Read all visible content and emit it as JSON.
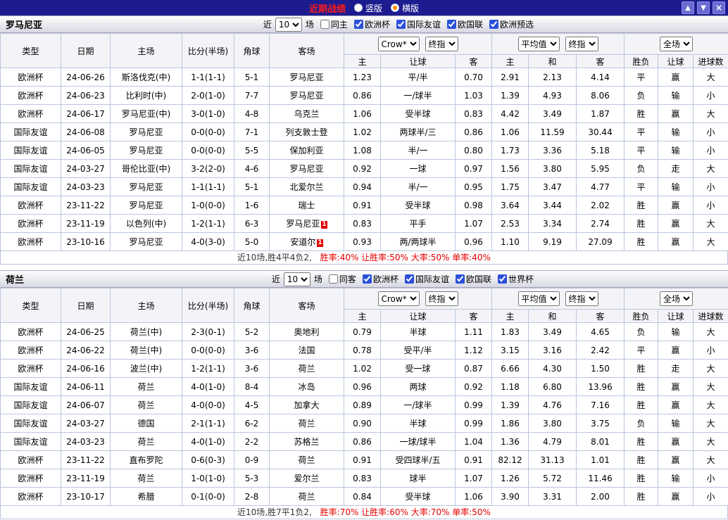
{
  "titlebar": {
    "title": "近期战绩",
    "vertical_label": "竖版",
    "horizontal_label": "横版",
    "up_button": "▲",
    "down_button": "▼",
    "close_button": "×"
  },
  "filter_labels": {
    "near": "近",
    "unit": "场"
  },
  "table_header": {
    "type": "类型",
    "date": "日期",
    "home": "主场",
    "score": "比分(半场)",
    "corners": "角球",
    "away": "客场",
    "crow": "Crow*",
    "final": "终指",
    "average": "平均值",
    "fulltime": "全场",
    "sub_home": "主",
    "sub_handicap": "让球",
    "sub_away": "客",
    "sub_draw": "和",
    "sub_outcome": "胜负",
    "sub_goals": "进球数"
  },
  "colors": {
    "titlebar_bg": "#1c1c90",
    "title_text": "#ff1a1a",
    "euro_type_bg": "#8d1010",
    "friendly_type_bg": "#2a2ac0",
    "focus_team": "#009900",
    "score_text": "#e60000",
    "win_big": "#e60000",
    "draw_lose": "#009900",
    "small": "#2727cc"
  },
  "sections": [
    {
      "team": "罗马尼亚",
      "filter": {
        "count": "10",
        "same_label": "同主",
        "same_checked": false,
        "leagues": [
          "欧洲杯",
          "国际友谊",
          "欧国联",
          "欧洲预选"
        ]
      },
      "rows": [
        {
          "type": "欧洲杯",
          "date": "24-06-26",
          "home": "斯洛伐克(中)",
          "home_focus": false,
          "score": "1-1(1-1)",
          "corners": "5-1",
          "away": "罗马尼亚",
          "away_focus": true,
          "away_red_card": "",
          "crow_home": "1.23",
          "handicap": "平/半",
          "crow_away": "0.70",
          "avg_home": "2.91",
          "avg_draw": "2.13",
          "avg_away": "4.14",
          "outcome": "平",
          "handicap_result": "赢",
          "goals_result": "大"
        },
        {
          "type": "欧洲杯",
          "date": "24-06-23",
          "home": "比利时(中)",
          "home_focus": false,
          "score": "2-0(1-0)",
          "corners": "7-7",
          "away": "罗马尼亚",
          "away_focus": true,
          "away_red_card": "",
          "crow_home": "0.86",
          "handicap": "一/球半",
          "crow_away": "1.03",
          "avg_home": "1.39",
          "avg_draw": "4.93",
          "avg_away": "8.06",
          "outcome": "负",
          "handicap_result": "输",
          "goals_result": "小"
        },
        {
          "type": "欧洲杯",
          "date": "24-06-17",
          "home": "罗马尼亚(中)",
          "home_focus": true,
          "score": "3-0(1-0)",
          "corners": "4-8",
          "away": "乌克兰",
          "away_focus": false,
          "away_red_card": "",
          "crow_home": "1.06",
          "handicap": "受半球",
          "crow_away": "0.83",
          "avg_home": "4.42",
          "avg_draw": "3.49",
          "avg_away": "1.87",
          "outcome": "胜",
          "handicap_result": "赢",
          "goals_result": "大"
        },
        {
          "type": "国际友谊",
          "date": "24-06-08",
          "home": "罗马尼亚",
          "home_focus": true,
          "score": "0-0(0-0)",
          "corners": "7-1",
          "away": "列支敦士登",
          "away_focus": false,
          "away_red_card": "",
          "crow_home": "1.02",
          "handicap": "两球半/三",
          "crow_away": "0.86",
          "avg_home": "1.06",
          "avg_draw": "11.59",
          "avg_away": "30.44",
          "outcome": "平",
          "handicap_result": "输",
          "goals_result": "小"
        },
        {
          "type": "国际友谊",
          "date": "24-06-05",
          "home": "罗马尼亚",
          "home_focus": true,
          "score": "0-0(0-0)",
          "corners": "5-5",
          "away": "保加利亚",
          "away_focus": false,
          "away_red_card": "",
          "crow_home": "1.08",
          "handicap": "半/一",
          "crow_away": "0.80",
          "avg_home": "1.73",
          "avg_draw": "3.36",
          "avg_away": "5.18",
          "outcome": "平",
          "handicap_result": "输",
          "goals_result": "小"
        },
        {
          "type": "国际友谊",
          "date": "24-03-27",
          "home": "哥伦比亚(中)",
          "home_focus": false,
          "score": "3-2(2-0)",
          "corners": "4-6",
          "away": "罗马尼亚",
          "away_focus": true,
          "away_red_card": "",
          "crow_home": "0.92",
          "handicap": "一球",
          "crow_away": "0.97",
          "avg_home": "1.56",
          "avg_draw": "3.80",
          "avg_away": "5.95",
          "outcome": "负",
          "handicap_result": "走",
          "goals_result": "大"
        },
        {
          "type": "国际友谊",
          "date": "24-03-23",
          "home": "罗马尼亚",
          "home_focus": true,
          "score": "1-1(1-1)",
          "corners": "5-1",
          "away": "北爱尔兰",
          "away_focus": false,
          "away_red_card": "",
          "crow_home": "0.94",
          "handicap": "半/一",
          "crow_away": "0.95",
          "avg_home": "1.75",
          "avg_draw": "3.47",
          "avg_away": "4.77",
          "outcome": "平",
          "handicap_result": "输",
          "goals_result": "小"
        },
        {
          "type": "欧洲杯",
          "date": "23-11-22",
          "home": "罗马尼亚",
          "home_focus": true,
          "score": "1-0(0-0)",
          "corners": "1-6",
          "away": "瑞士",
          "away_focus": false,
          "away_red_card": "",
          "crow_home": "0.91",
          "handicap": "受半球",
          "crow_away": "0.98",
          "avg_home": "3.64",
          "avg_draw": "3.44",
          "avg_away": "2.02",
          "outcome": "胜",
          "handicap_result": "赢",
          "goals_result": "小"
        },
        {
          "type": "欧洲杯",
          "date": "23-11-19",
          "home": "以色列(中)",
          "home_focus": false,
          "score": "1-2(1-1)",
          "corners": "6-3",
          "away": "罗马尼亚",
          "away_focus": true,
          "away_red_card": "1",
          "crow_home": "0.83",
          "handicap": "平手",
          "crow_away": "1.07",
          "avg_home": "2.53",
          "avg_draw": "3.34",
          "avg_away": "2.74",
          "outcome": "胜",
          "handicap_result": "赢",
          "goals_result": "大"
        },
        {
          "type": "欧洲杯",
          "date": "23-10-16",
          "home": "罗马尼亚",
          "home_focus": true,
          "score": "4-0(3-0)",
          "corners": "5-0",
          "away": "安道尔",
          "away_focus": false,
          "away_red_card": "1",
          "crow_home": "0.93",
          "handicap": "两/两球半",
          "crow_away": "0.96",
          "avg_home": "1.10",
          "avg_draw": "9.19",
          "avg_away": "27.09",
          "outcome": "胜",
          "handicap_result": "赢",
          "goals_result": "大"
        }
      ],
      "summary": {
        "prefix": "近10场,胜4平4负2,",
        "stats": "胜率:40%  让胜率:50%  大率:50%  单率:40%"
      }
    },
    {
      "team": "荷兰",
      "filter": {
        "count": "10",
        "same_label": "同客",
        "same_checked": false,
        "leagues": [
          "欧洲杯",
          "国际友谊",
          "欧国联",
          "世界杯"
        ]
      },
      "rows": [
        {
          "type": "欧洲杯",
          "date": "24-06-25",
          "home": "荷兰(中)",
          "home_focus": true,
          "score": "2-3(0-1)",
          "corners": "5-2",
          "away": "奥地利",
          "away_focus": false,
          "away_red_card": "",
          "crow_home": "0.79",
          "handicap": "半球",
          "crow_away": "1.11",
          "avg_home": "1.83",
          "avg_draw": "3.49",
          "avg_away": "4.65",
          "outcome": "负",
          "handicap_result": "输",
          "goals_result": "大"
        },
        {
          "type": "欧洲杯",
          "date": "24-06-22",
          "home": "荷兰(中)",
          "home_focus": true,
          "score": "0-0(0-0)",
          "corners": "3-6",
          "away": "法国",
          "away_focus": false,
          "away_red_card": "",
          "crow_home": "0.78",
          "handicap": "受平/半",
          "crow_away": "1.12",
          "avg_home": "3.15",
          "avg_draw": "3.16",
          "avg_away": "2.42",
          "outcome": "平",
          "handicap_result": "赢",
          "goals_result": "小"
        },
        {
          "type": "欧洲杯",
          "date": "24-06-16",
          "home": "波兰(中)",
          "home_focus": false,
          "score": "1-2(1-1)",
          "corners": "3-6",
          "away": "荷兰",
          "away_focus": true,
          "away_red_card": "",
          "crow_home": "1.02",
          "handicap": "受一球",
          "crow_away": "0.87",
          "avg_home": "6.66",
          "avg_draw": "4.30",
          "avg_away": "1.50",
          "outcome": "胜",
          "handicap_result": "走",
          "goals_result": "大"
        },
        {
          "type": "国际友谊",
          "date": "24-06-11",
          "home": "荷兰",
          "home_focus": true,
          "score": "4-0(1-0)",
          "corners": "8-4",
          "away": "冰岛",
          "away_focus": false,
          "away_red_card": "",
          "crow_home": "0.96",
          "handicap": "两球",
          "crow_away": "0.92",
          "avg_home": "1.18",
          "avg_draw": "6.80",
          "avg_away": "13.96",
          "outcome": "胜",
          "handicap_result": "赢",
          "goals_result": "大"
        },
        {
          "type": "国际友谊",
          "date": "24-06-07",
          "home": "荷兰",
          "home_focus": true,
          "score": "4-0(0-0)",
          "corners": "4-5",
          "away": "加拿大",
          "away_focus": false,
          "away_red_card": "",
          "crow_home": "0.89",
          "handicap": "一/球半",
          "crow_away": "0.99",
          "avg_home": "1.39",
          "avg_draw": "4.76",
          "avg_away": "7.16",
          "outcome": "胜",
          "handicap_result": "赢",
          "goals_result": "大"
        },
        {
          "type": "国际友谊",
          "date": "24-03-27",
          "home": "德国",
          "home_focus": false,
          "score": "2-1(1-1)",
          "corners": "6-2",
          "away": "荷兰",
          "away_focus": true,
          "away_red_card": "",
          "crow_home": "0.90",
          "handicap": "半球",
          "crow_away": "0.99",
          "avg_home": "1.86",
          "avg_draw": "3.80",
          "avg_away": "3.75",
          "outcome": "负",
          "handicap_result": "输",
          "goals_result": "大"
        },
        {
          "type": "国际友谊",
          "date": "24-03-23",
          "home": "荷兰",
          "home_focus": true,
          "score": "4-0(1-0)",
          "corners": "2-2",
          "away": "苏格兰",
          "away_focus": false,
          "away_red_card": "",
          "crow_home": "0.86",
          "handicap": "一球/球半",
          "crow_away": "1.04",
          "avg_home": "1.36",
          "avg_draw": "4.79",
          "avg_away": "8.01",
          "outcome": "胜",
          "handicap_result": "赢",
          "goals_result": "大"
        },
        {
          "type": "欧洲杯",
          "date": "23-11-22",
          "home": "直布罗陀",
          "home_focus": false,
          "score": "0-6(0-3)",
          "corners": "0-9",
          "away": "荷兰",
          "away_focus": true,
          "away_red_card": "",
          "crow_home": "0.91",
          "handicap": "受四球半/五",
          "crow_away": "0.91",
          "avg_home": "82.12",
          "avg_draw": "31.13",
          "avg_away": "1.01",
          "outcome": "胜",
          "handicap_result": "赢",
          "goals_result": "大"
        },
        {
          "type": "欧洲杯",
          "date": "23-11-19",
          "home": "荷兰",
          "home_focus": true,
          "score": "1-0(1-0)",
          "corners": "5-3",
          "away": "爱尔兰",
          "away_focus": false,
          "away_red_card": "",
          "crow_home": "0.83",
          "handicap": "球半",
          "crow_away": "1.07",
          "avg_home": "1.26",
          "avg_draw": "5.72",
          "avg_away": "11.46",
          "outcome": "胜",
          "handicap_result": "输",
          "goals_result": "小"
        },
        {
          "type": "欧洲杯",
          "date": "23-10-17",
          "home": "希腊",
          "home_focus": false,
          "score": "0-1(0-0)",
          "corners": "2-8",
          "away": "荷兰",
          "away_focus": true,
          "away_red_card": "",
          "crow_home": "0.84",
          "handicap": "受半球",
          "crow_away": "1.06",
          "avg_home": "3.90",
          "avg_draw": "3.31",
          "avg_away": "2.00",
          "outcome": "胜",
          "handicap_result": "赢",
          "goals_result": "小"
        }
      ],
      "summary": {
        "prefix": "近10场,胜7平1负2,",
        "stats": "胜率:70%  让胜率:60%  大率:70%  单率:50%"
      }
    }
  ]
}
